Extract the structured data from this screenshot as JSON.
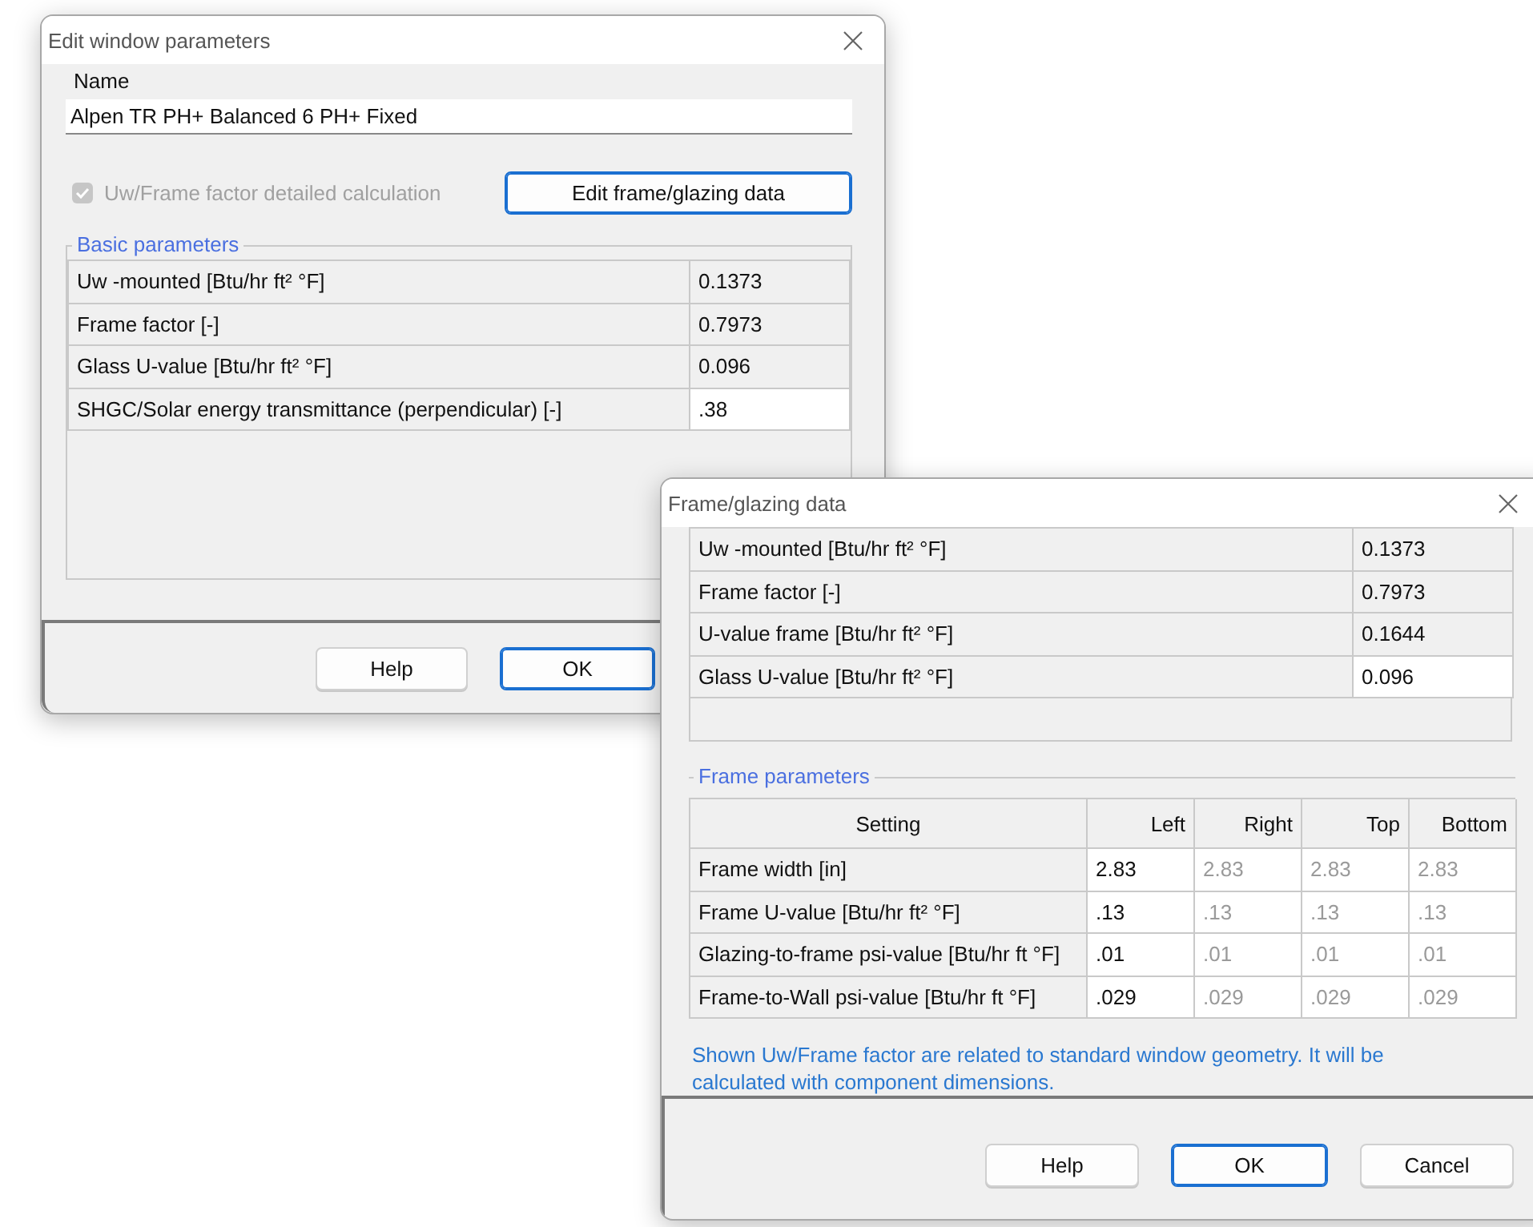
{
  "edit_window": {
    "title": "Edit window parameters",
    "name_label": "Name",
    "name_value": "Alpen TR PH+ Balanced 6 PH+ Fixed",
    "checkbox": {
      "label": "Uw/Frame factor detailed calculation",
      "checked": true,
      "disabled": true
    },
    "edit_button": "Edit frame/glazing data",
    "group_title": "Basic parameters",
    "rows": [
      {
        "label": "Uw -mounted  [Btu/hr ft² °F]",
        "value": "0.1373",
        "editable": false
      },
      {
        "label": "Frame factor  [-]",
        "value": "0.7973",
        "editable": false
      },
      {
        "label": "Glass U-value  [Btu/hr ft² °F]",
        "value": "0.096",
        "editable": false
      },
      {
        "label": "SHGC/Solar energy transmittance (perpendicular)  [-]",
        "value": ".38",
        "editable": true
      }
    ],
    "buttons": [
      {
        "label": "Help",
        "default": false
      },
      {
        "label": "OK",
        "default": true
      }
    ]
  },
  "frame_dialog": {
    "title": "Frame/glazing data",
    "rows": [
      {
        "label": "Uw -mounted  [Btu/hr ft² °F]",
        "value": "0.1373",
        "editable": false
      },
      {
        "label": "Frame factor  [-]",
        "value": "0.7973",
        "editable": false
      },
      {
        "label": "U-value frame  [Btu/hr ft² °F]",
        "value": "0.1644",
        "editable": false
      },
      {
        "label": "Glass U-value  [Btu/hr ft² °F]",
        "value": "0.096",
        "editable": true
      }
    ],
    "group_title": "Frame parameters",
    "columns": [
      "Setting",
      "Left",
      "Right",
      "Top",
      "Bottom"
    ],
    "param_rows": [
      {
        "label": "Frame width [in]",
        "cells": [
          {
            "value": "2.83",
            "disabled": false
          },
          {
            "value": "2.83",
            "disabled": true
          },
          {
            "value": "2.83",
            "disabled": true
          },
          {
            "value": "2.83",
            "disabled": true
          }
        ]
      },
      {
        "label": "Frame U-value [Btu/hr ft² °F]",
        "cells": [
          {
            "value": ".13",
            "disabled": false
          },
          {
            "value": ".13",
            "disabled": true
          },
          {
            "value": ".13",
            "disabled": true
          },
          {
            "value": ".13",
            "disabled": true
          }
        ]
      },
      {
        "label": "Glazing-to-frame psi-value [Btu/hr ft °F]",
        "cells": [
          {
            "value": ".01",
            "disabled": false
          },
          {
            "value": ".01",
            "disabled": true
          },
          {
            "value": ".01",
            "disabled": true
          },
          {
            "value": ".01",
            "disabled": true
          }
        ]
      },
      {
        "label": "Frame-to-Wall psi-value [Btu/hr ft °F]",
        "cells": [
          {
            "value": ".029",
            "disabled": false
          },
          {
            "value": ".029",
            "disabled": true
          },
          {
            "value": ".029",
            "disabled": true
          },
          {
            "value": ".029",
            "disabled": true
          }
        ]
      }
    ],
    "note": "Shown Uw/Frame factor are related to standard window geometry. It will be calculated with component dimensions.",
    "buttons": [
      {
        "label": "Help",
        "default": false
      },
      {
        "label": "OK",
        "default": true
      },
      {
        "label": "Cancel",
        "default": false
      }
    ]
  }
}
